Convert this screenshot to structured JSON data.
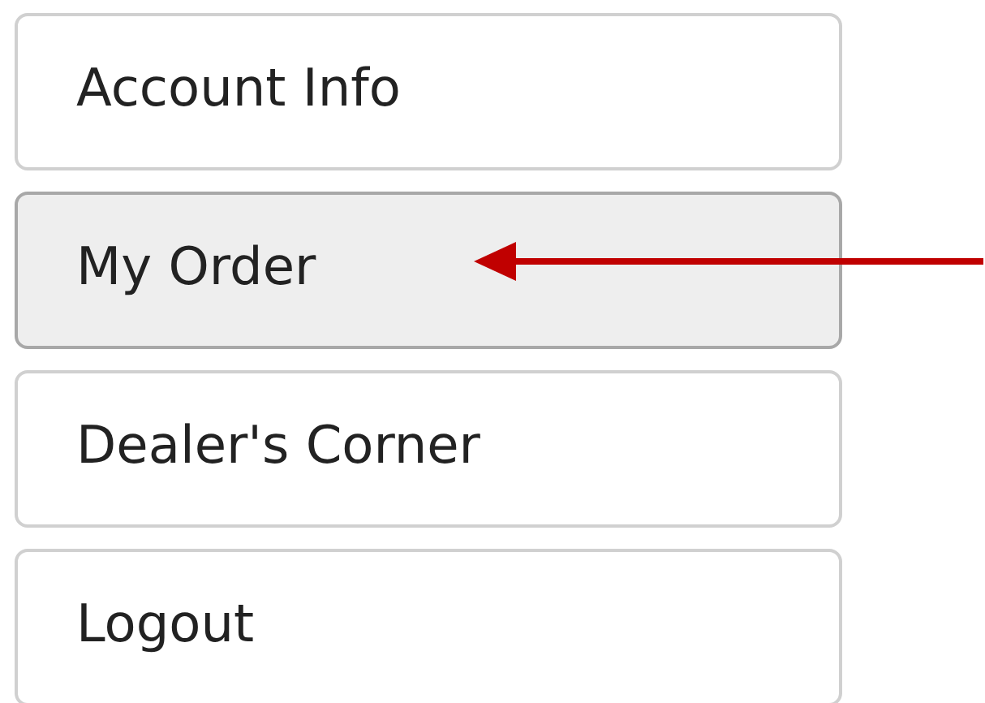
{
  "menu": {
    "items": [
      {
        "label": "Account Info",
        "selected": false
      },
      {
        "label": "My Order",
        "selected": true
      },
      {
        "label": "Dealer's Corner",
        "selected": false
      },
      {
        "label": "Logout",
        "selected": false
      }
    ]
  }
}
